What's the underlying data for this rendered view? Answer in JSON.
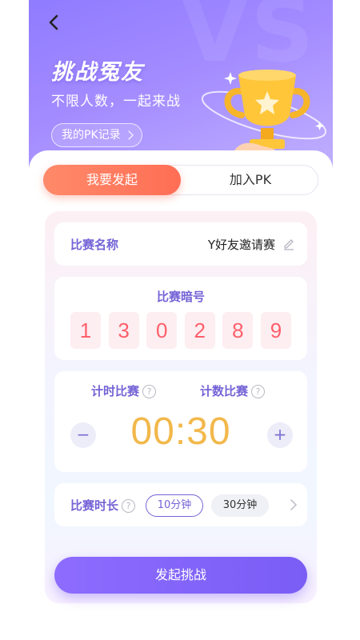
{
  "header": {
    "watermark": "VS",
    "title": "挑战冤友",
    "subtitle": "不限人数，一起来战",
    "pk_record_label": "我的PK记录"
  },
  "tabs": [
    {
      "label": "我要发起",
      "active": true
    },
    {
      "label": "加入PK",
      "active": false
    }
  ],
  "match_name": {
    "label": "比赛名称",
    "value": "Y好友邀请赛"
  },
  "secret_code": {
    "label": "比赛暗号",
    "digits": [
      "1",
      "3",
      "0",
      "2",
      "8",
      "9"
    ]
  },
  "timer": {
    "mode_timed": "计时比赛",
    "mode_count": "计数比赛",
    "help_glyph": "?",
    "minus": "−",
    "plus": "+",
    "value": "00:30"
  },
  "duration": {
    "label": "比赛时长",
    "options": [
      {
        "label": "10分钟",
        "selected": true
      },
      {
        "label": "30分钟",
        "selected": false
      }
    ]
  },
  "start_button": "发起挑战",
  "colors": {
    "accent_purple": "#7463d6",
    "tab_active_orange": "#ff6e55",
    "digit_red": "#ff5f6b",
    "timer_gold": "#f2b84b"
  },
  "icons": [
    "back-arrow-icon",
    "chevron-right-icon",
    "trophy-icon",
    "edit-pencil-icon",
    "help-icon",
    "more-chevron-icon"
  ]
}
